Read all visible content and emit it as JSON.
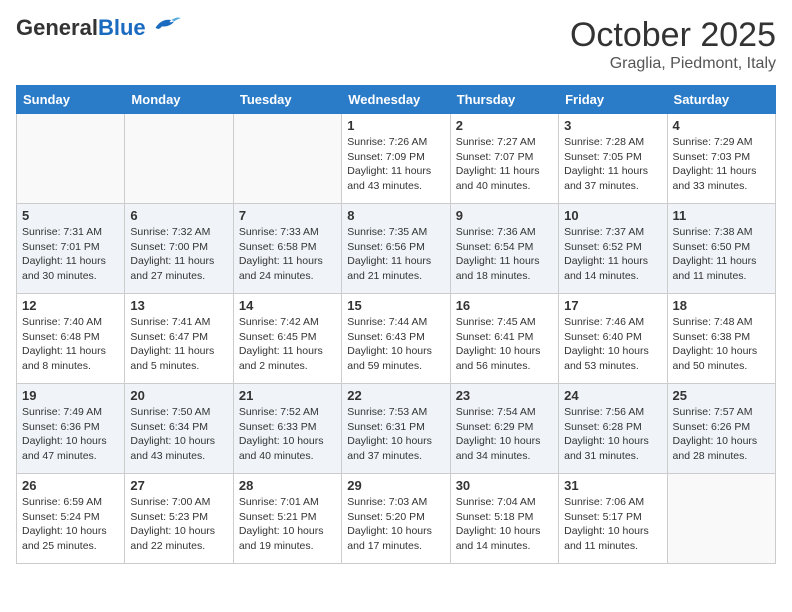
{
  "header": {
    "logo_general": "General",
    "logo_blue": "Blue",
    "month": "October 2025",
    "location": "Graglia, Piedmont, Italy"
  },
  "weekdays": [
    "Sunday",
    "Monday",
    "Tuesday",
    "Wednesday",
    "Thursday",
    "Friday",
    "Saturday"
  ],
  "weeks": [
    [
      {
        "day": "",
        "info": ""
      },
      {
        "day": "",
        "info": ""
      },
      {
        "day": "",
        "info": ""
      },
      {
        "day": "1",
        "info": "Sunrise: 7:26 AM\nSunset: 7:09 PM\nDaylight: 11 hours\nand 43 minutes."
      },
      {
        "day": "2",
        "info": "Sunrise: 7:27 AM\nSunset: 7:07 PM\nDaylight: 11 hours\nand 40 minutes."
      },
      {
        "day": "3",
        "info": "Sunrise: 7:28 AM\nSunset: 7:05 PM\nDaylight: 11 hours\nand 37 minutes."
      },
      {
        "day": "4",
        "info": "Sunrise: 7:29 AM\nSunset: 7:03 PM\nDaylight: 11 hours\nand 33 minutes."
      }
    ],
    [
      {
        "day": "5",
        "info": "Sunrise: 7:31 AM\nSunset: 7:01 PM\nDaylight: 11 hours\nand 30 minutes."
      },
      {
        "day": "6",
        "info": "Sunrise: 7:32 AM\nSunset: 7:00 PM\nDaylight: 11 hours\nand 27 minutes."
      },
      {
        "day": "7",
        "info": "Sunrise: 7:33 AM\nSunset: 6:58 PM\nDaylight: 11 hours\nand 24 minutes."
      },
      {
        "day": "8",
        "info": "Sunrise: 7:35 AM\nSunset: 6:56 PM\nDaylight: 11 hours\nand 21 minutes."
      },
      {
        "day": "9",
        "info": "Sunrise: 7:36 AM\nSunset: 6:54 PM\nDaylight: 11 hours\nand 18 minutes."
      },
      {
        "day": "10",
        "info": "Sunrise: 7:37 AM\nSunset: 6:52 PM\nDaylight: 11 hours\nand 14 minutes."
      },
      {
        "day": "11",
        "info": "Sunrise: 7:38 AM\nSunset: 6:50 PM\nDaylight: 11 hours\nand 11 minutes."
      }
    ],
    [
      {
        "day": "12",
        "info": "Sunrise: 7:40 AM\nSunset: 6:48 PM\nDaylight: 11 hours\nand 8 minutes."
      },
      {
        "day": "13",
        "info": "Sunrise: 7:41 AM\nSunset: 6:47 PM\nDaylight: 11 hours\nand 5 minutes."
      },
      {
        "day": "14",
        "info": "Sunrise: 7:42 AM\nSunset: 6:45 PM\nDaylight: 11 hours\nand 2 minutes."
      },
      {
        "day": "15",
        "info": "Sunrise: 7:44 AM\nSunset: 6:43 PM\nDaylight: 10 hours\nand 59 minutes."
      },
      {
        "day": "16",
        "info": "Sunrise: 7:45 AM\nSunset: 6:41 PM\nDaylight: 10 hours\nand 56 minutes."
      },
      {
        "day": "17",
        "info": "Sunrise: 7:46 AM\nSunset: 6:40 PM\nDaylight: 10 hours\nand 53 minutes."
      },
      {
        "day": "18",
        "info": "Sunrise: 7:48 AM\nSunset: 6:38 PM\nDaylight: 10 hours\nand 50 minutes."
      }
    ],
    [
      {
        "day": "19",
        "info": "Sunrise: 7:49 AM\nSunset: 6:36 PM\nDaylight: 10 hours\nand 47 minutes."
      },
      {
        "day": "20",
        "info": "Sunrise: 7:50 AM\nSunset: 6:34 PM\nDaylight: 10 hours\nand 43 minutes."
      },
      {
        "day": "21",
        "info": "Sunrise: 7:52 AM\nSunset: 6:33 PM\nDaylight: 10 hours\nand 40 minutes."
      },
      {
        "day": "22",
        "info": "Sunrise: 7:53 AM\nSunset: 6:31 PM\nDaylight: 10 hours\nand 37 minutes."
      },
      {
        "day": "23",
        "info": "Sunrise: 7:54 AM\nSunset: 6:29 PM\nDaylight: 10 hours\nand 34 minutes."
      },
      {
        "day": "24",
        "info": "Sunrise: 7:56 AM\nSunset: 6:28 PM\nDaylight: 10 hours\nand 31 minutes."
      },
      {
        "day": "25",
        "info": "Sunrise: 7:57 AM\nSunset: 6:26 PM\nDaylight: 10 hours\nand 28 minutes."
      }
    ],
    [
      {
        "day": "26",
        "info": "Sunrise: 6:59 AM\nSunset: 5:24 PM\nDaylight: 10 hours\nand 25 minutes."
      },
      {
        "day": "27",
        "info": "Sunrise: 7:00 AM\nSunset: 5:23 PM\nDaylight: 10 hours\nand 22 minutes."
      },
      {
        "day": "28",
        "info": "Sunrise: 7:01 AM\nSunset: 5:21 PM\nDaylight: 10 hours\nand 19 minutes."
      },
      {
        "day": "29",
        "info": "Sunrise: 7:03 AM\nSunset: 5:20 PM\nDaylight: 10 hours\nand 17 minutes."
      },
      {
        "day": "30",
        "info": "Sunrise: 7:04 AM\nSunset: 5:18 PM\nDaylight: 10 hours\nand 14 minutes."
      },
      {
        "day": "31",
        "info": "Sunrise: 7:06 AM\nSunset: 5:17 PM\nDaylight: 10 hours\nand 11 minutes."
      },
      {
        "day": "",
        "info": ""
      }
    ]
  ]
}
